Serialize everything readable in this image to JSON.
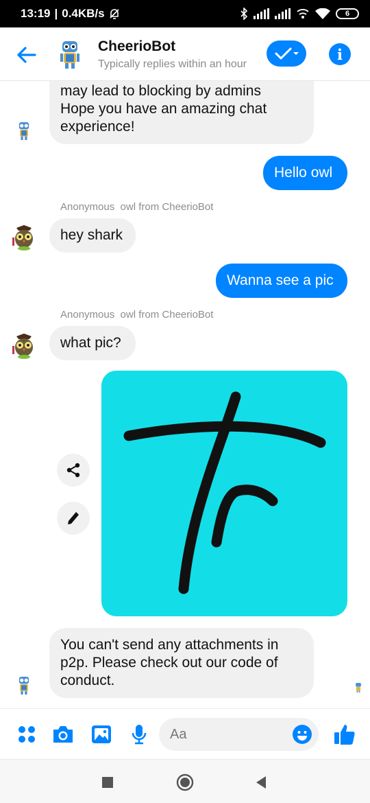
{
  "status_bar": {
    "time": "13:19",
    "network_speed": "0.4KB/s",
    "battery_level": "6",
    "icons": [
      "mute-bell-icon",
      "bluetooth-icon",
      "signal-icon",
      "signal-icon",
      "wifi-calling-icon",
      "wifi-icon",
      "battery-icon"
    ]
  },
  "header": {
    "title": "CheerioBot",
    "subtitle": "Typically replies within an hour",
    "accent_color": "#0084ff"
  },
  "messages": [
    {
      "direction": "in",
      "sender": "bot",
      "text_lines": [
        "may lead to blocking by admins",
        "Hope you have an amazing chat",
        "experience!"
      ]
    },
    {
      "direction": "out",
      "text": "Hello owl"
    },
    {
      "direction": "in",
      "sender_label": "Anonymous  owl from CheerioBot",
      "text": "hey shark"
    },
    {
      "direction": "out",
      "text": "Wanna see a pic"
    },
    {
      "direction": "in",
      "sender_label": "Anonymous  owl from CheerioBot",
      "text": "what pic?"
    },
    {
      "direction": "out",
      "type": "image",
      "image_desc_color": "#13dee8"
    },
    {
      "direction": "in",
      "sender": "bot",
      "text_lines": [
        "You can't send any attachments in",
        "p2p. Please check out our code of",
        "conduct."
      ]
    }
  ],
  "composer": {
    "placeholder": "Aa",
    "icons": [
      "apps-icon",
      "camera-icon",
      "gallery-icon",
      "microphone-icon",
      "emoji-icon",
      "like-icon"
    ]
  },
  "navbar": {
    "icons": [
      "recents-icon",
      "home-icon",
      "back-icon"
    ]
  }
}
